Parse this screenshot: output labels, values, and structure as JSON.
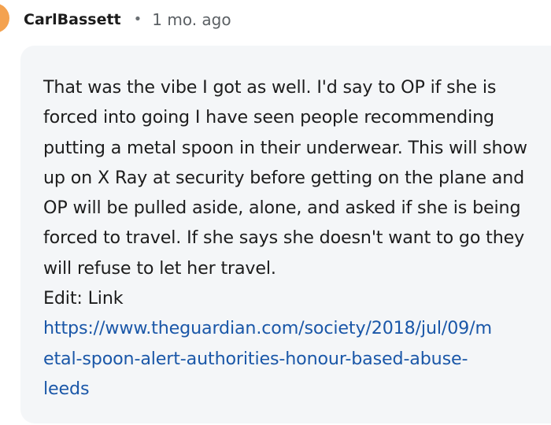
{
  "comment": {
    "author": "CarlBassett",
    "separator": "•",
    "timestamp": "1 mo. ago",
    "body": "That was the vibe I got as well. I'd say to OP if she is forced into going I have seen people recommending putting a metal spoon in their underwear. This will show up on X Ray at security before getting on the plane and OP will be pulled aside, alone, and asked if she is being forced to travel. If she says she doesn't want to go they will refuse to let her travel.",
    "edit_text": "Edit: Link",
    "link_lines": [
      "https://www.theguardian.com/society/2018/jul/09/m",
      "etal-spoon-alert-authorities-honour-based-abuse-",
      "leeds"
    ]
  },
  "colors": {
    "avatar": "#f4a24f",
    "bubble_background": "#f4f6f8",
    "link": "#1a57a8"
  }
}
